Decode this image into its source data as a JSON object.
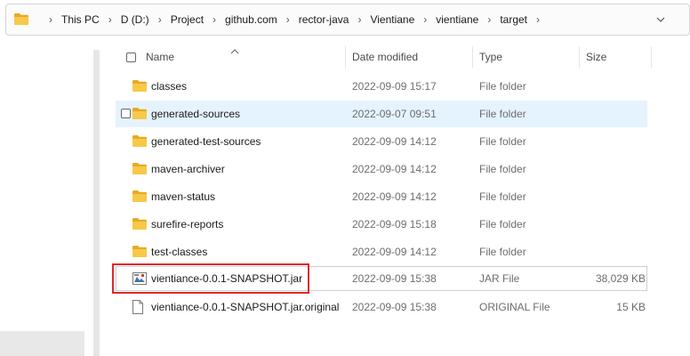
{
  "address_bar": {
    "icon": "folder-icon",
    "breadcrumbs": [
      "This PC",
      "D (D:)",
      "Project",
      "github.com",
      "rector-java",
      "Vientiane",
      "vientiane",
      "target"
    ],
    "dropdown_icon": "chevron-down-icon"
  },
  "columns": {
    "name": "Name",
    "date": "Date modified",
    "type": "Type",
    "size": "Size"
  },
  "files": [
    {
      "name": "classes",
      "date": "2022-09-09 15:17",
      "type": "File folder",
      "size": "",
      "icon": "folder-icon"
    },
    {
      "name": "generated-sources",
      "date": "2022-09-07 09:51",
      "type": "File folder",
      "size": "",
      "icon": "folder-icon"
    },
    {
      "name": "generated-test-sources",
      "date": "2022-09-09 14:12",
      "type": "File folder",
      "size": "",
      "icon": "folder-icon"
    },
    {
      "name": "maven-archiver",
      "date": "2022-09-09 14:12",
      "type": "File folder",
      "size": "",
      "icon": "folder-icon"
    },
    {
      "name": "maven-status",
      "date": "2022-09-09 14:12",
      "type": "File folder",
      "size": "",
      "icon": "folder-icon"
    },
    {
      "name": "surefire-reports",
      "date": "2022-09-09 15:18",
      "type": "File folder",
      "size": "",
      "icon": "folder-icon"
    },
    {
      "name": "test-classes",
      "date": "2022-09-09 14:12",
      "type": "File folder",
      "size": "",
      "icon": "folder-icon"
    },
    {
      "name": "vientiance-0.0.1-SNAPSHOT.jar",
      "date": "2022-09-09 15:38",
      "type": "JAR File",
      "size": "38,029 KB",
      "icon": "jar-file-icon"
    },
    {
      "name": "vientiance-0.0.1-SNAPSHOT.jar.original",
      "date": "2022-09-09 15:38",
      "type": "ORIGINAL File",
      "size": "15 KB",
      "icon": "file-icon"
    }
  ],
  "colors": {
    "folder": "#f4c542",
    "hover_row": "#e5f3ff",
    "highlight_border": "#e0282a"
  }
}
